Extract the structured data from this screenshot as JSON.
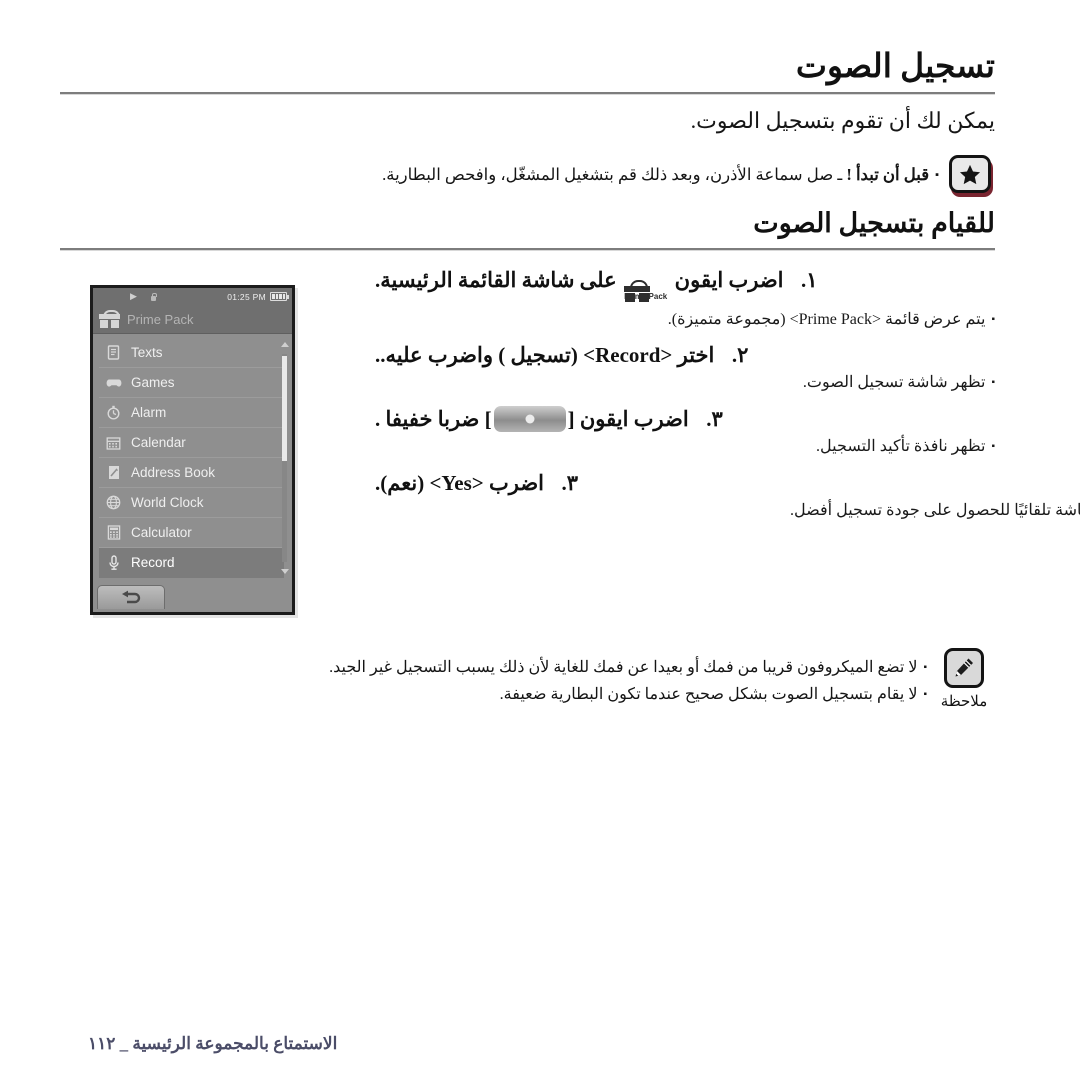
{
  "document": {
    "chapter_title": "تسجيل الصوت",
    "intro": "يمكن لك أن تقوم بتسجيل الصوت.",
    "section_title": "للقيام بتسجيل الصوت"
  },
  "tip": {
    "icon": "star-icon",
    "bullet": "▪",
    "lead": "قبل أن تبدأ !",
    "text": "ـ صل سماعة الأذرن، وبعد ذلك قم بتشغيل المشغّل، وافحص البطارية."
  },
  "device": {
    "status": {
      "play_icon": "play-icon",
      "lock_icon": "lock-icon",
      "time": "01:25 PM",
      "battery_icon": "battery-icon"
    },
    "title": "Prime Pack",
    "title_icon": "gift-box-icon",
    "menu_items": [
      {
        "label": "Texts",
        "icon": "document-icon",
        "selected": false
      },
      {
        "label": "Games",
        "icon": "gamepad-icon",
        "selected": false
      },
      {
        "label": "Alarm",
        "icon": "alarm-clock-icon",
        "selected": false
      },
      {
        "label": "Calendar",
        "icon": "calendar-icon",
        "selected": false
      },
      {
        "label": "Address Book",
        "icon": "address-book-icon",
        "selected": false
      },
      {
        "label": "World Clock",
        "icon": "globe-icon",
        "selected": false
      },
      {
        "label": "Calculator",
        "icon": "calculator-icon",
        "selected": false
      },
      {
        "label": "Record",
        "icon": "microphone-icon",
        "selected": true
      }
    ],
    "back_button": "back-arrow-icon",
    "scrollbar": "vertical-scrollbar"
  },
  "steps": [
    {
      "num": "١.",
      "pre": "اضرب ايقون",
      "icon_caption": "Prime Pack",
      "post": "على شاشة القائمة الرئيسية.",
      "bullet": "▪",
      "sub": "يتم عرض قائمة <Prime Pack> (مجموعة متميزة)."
    },
    {
      "num": "٢.",
      "text": "اختر <Record> (تسجيل ) واضرب عليه..",
      "bullet": "▪",
      "sub": "تظهر شاشة تسجيل الصوت."
    },
    {
      "num": "٣.",
      "pre": "اضرب ايقون [",
      "post": "] ضربا خفيفا .",
      "bullet": "▪",
      "sub": "تظهر نافذة تأكيد التسجيل."
    },
    {
      "num": "٣.",
      "text": "اضرب <Yes> (نعم).",
      "bullet": "▪",
      "sub": "يبدأ التسجيل ويتم إيقاف الشاشة تلقائيًا للحصول على جودة تسجيل أفضل."
    }
  ],
  "note": {
    "icon": "pen-note-icon",
    "label": "ملاحظة",
    "bullet": "▪",
    "lines": [
      "لا تضع الميكروفون قريبا من فمك أو بعيدا عن فمك للغاية لأن ذلك يسبب التسجيل غير الجيد.",
      "لا يقام بتسجيل الصوت بشكل صحيح عندما تكون البطارية ضعيفة."
    ]
  },
  "footer": {
    "text": "الاستمتاع بالمجموعة الرئيسية",
    "separator": "_",
    "page_number": "١١٢"
  },
  "colors": {
    "accent_badge_shadow": "#7a2530",
    "footer_text": "#4b4d68",
    "device_bg": "#8f8f8f",
    "device_header": "#6f6f6f",
    "device_selected": "#7c7c7c"
  }
}
